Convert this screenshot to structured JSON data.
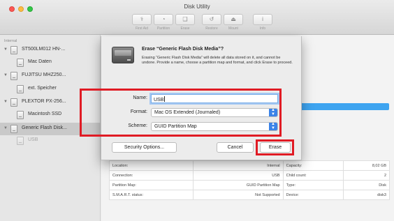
{
  "window": {
    "title": "Disk Utility"
  },
  "toolbar": {
    "buttons": [
      {
        "label": "First Aid",
        "icon": "first-aid-icon",
        "glyph": "⚕"
      },
      {
        "label": "Partition",
        "icon": "partition-icon",
        "glyph": "◔"
      },
      {
        "label": "Erase",
        "icon": "erase-icon",
        "glyph": "❑"
      },
      {
        "label": "Restore",
        "icon": "restore-icon",
        "glyph": "↺"
      },
      {
        "label": "Mount",
        "icon": "mount-icon",
        "glyph": "⏏"
      },
      {
        "label": "Info",
        "icon": "info-icon",
        "glyph": "i"
      }
    ]
  },
  "sidebar": {
    "header": "Internal",
    "items": [
      {
        "label": "ST500LM012 HN-...",
        "level": 0
      },
      {
        "label": "Mac Daten",
        "level": 1
      },
      {
        "label": "FUJITSU MHZ250...",
        "level": 0
      },
      {
        "label": "ext. Speicher",
        "level": 1
      },
      {
        "label": "PLEXTOR PX-256...",
        "level": 0
      },
      {
        "label": "Macintosh SSD",
        "level": 1
      },
      {
        "label": "Generic Flash Disk...",
        "level": 0,
        "selected": true
      },
      {
        "label": "USB",
        "level": 1,
        "dim": true
      }
    ]
  },
  "sheet": {
    "title": "Erase “Generic Flash Disk Media”?",
    "description": "Erasing “Generic Flash Disk Media” will delete all data stored on it, and cannot be undone. Provide a name, choose a partition map and format, and click Erase to proceed.",
    "name_label": "Name:",
    "name_value": "USB",
    "format_label": "Format:",
    "format_value": "Mac OS Extended (Journaled)",
    "scheme_label": "Scheme:",
    "scheme_value": "GUID Partition Map",
    "security_label": "Security Options...",
    "cancel_label": "Cancel",
    "erase_label": "Erase"
  },
  "info_table": {
    "rows": [
      [
        "Location:",
        "Internal",
        "Capacity:",
        "8,02 GB"
      ],
      [
        "Connection:",
        "USB",
        "Child count:",
        "2"
      ],
      [
        "Partition Map:",
        "GUID Partition Map",
        "Type:",
        "Disk"
      ],
      [
        "S.M.A.R.T. status:",
        "Not Supported",
        "Device:",
        "disk3"
      ]
    ]
  },
  "colors": {
    "highlight_red": "#e01b24",
    "accent_blue": "#3b83e8"
  }
}
